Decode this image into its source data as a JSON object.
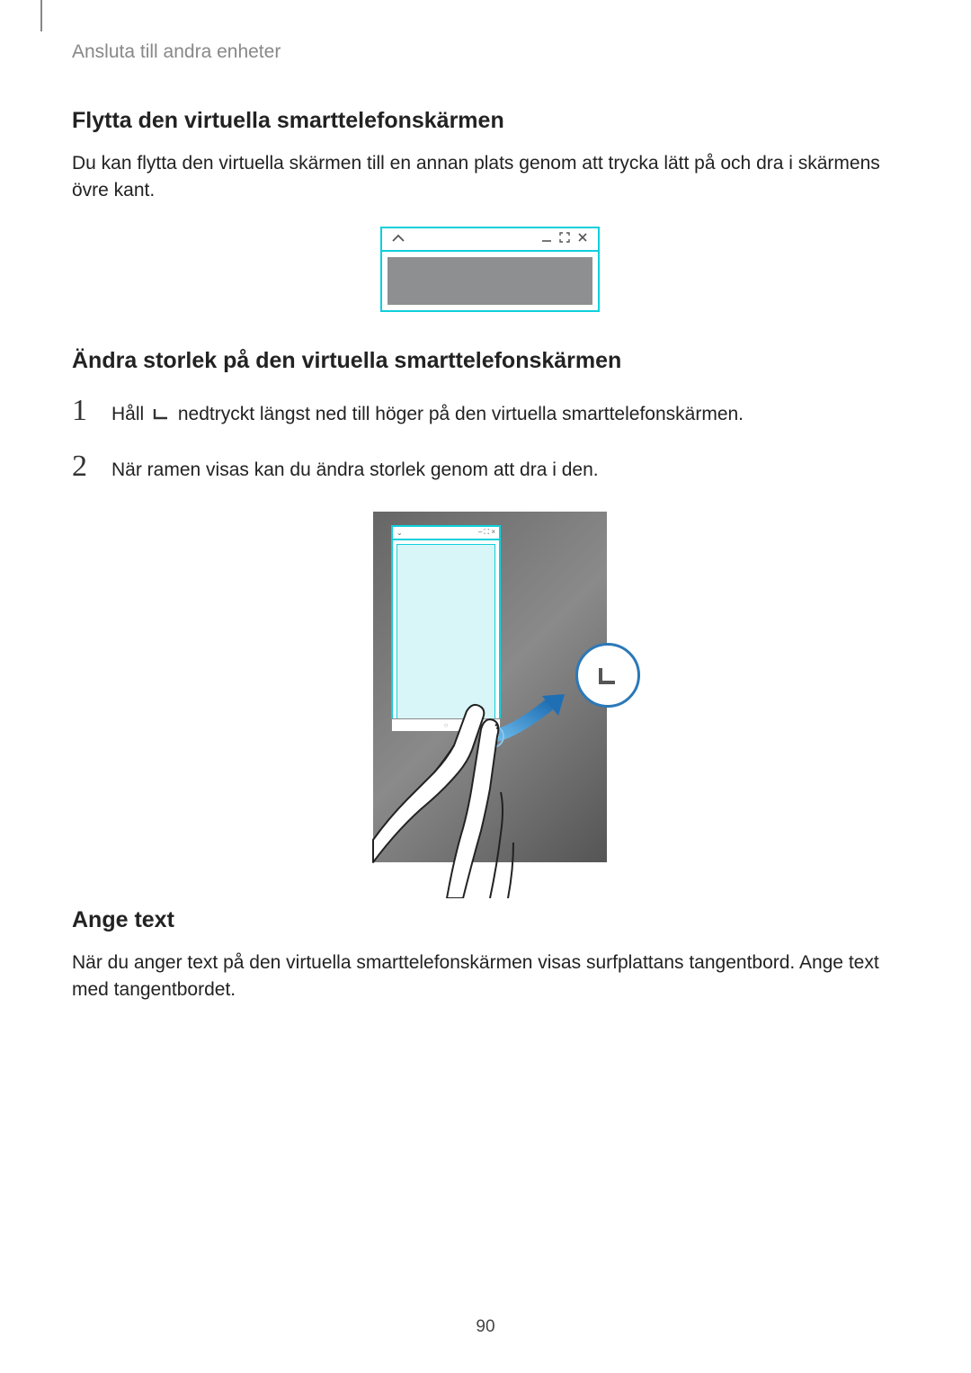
{
  "breadcrumb": "Ansluta till andra enheter",
  "section1": {
    "heading": "Flytta den virtuella smarttelefonskärmen",
    "body": "Du kan flytta den virtuella skärmen till en annan plats genom att trycka lätt på och dra i skärmens övre kant."
  },
  "section2": {
    "heading": "Ändra storlek på den virtuella smarttelefonskärmen",
    "steps": [
      {
        "num": "1",
        "before": "Håll ",
        "after": " nedtryckt längst ned till höger på den virtuella smarttelefonskärmen."
      },
      {
        "num": "2",
        "before": "När ramen visas kan du ändra storlek genom att dra i den.",
        "after": ""
      }
    ]
  },
  "section3": {
    "heading": "Ange text",
    "body": "När du anger text på den virtuella smarttelefonskärmen visas surfplattans tangentbord. Ange text med tangentbordet."
  },
  "page_number": "90",
  "icons": {
    "chevron_up": "chevron-up-icon",
    "minimize": "minimize-icon",
    "maximize": "maximize-icon",
    "close": "close-icon",
    "resize_corner": "resize-corner-icon"
  }
}
